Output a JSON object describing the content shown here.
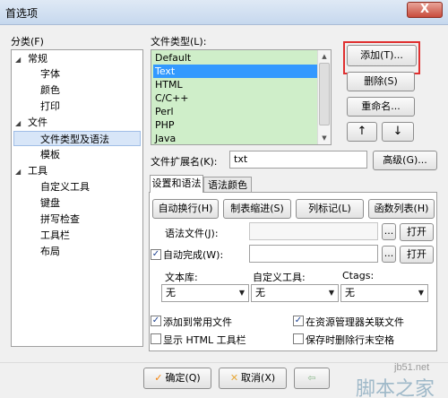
{
  "window": {
    "title": "首选项",
    "close_glyph": "X"
  },
  "category": {
    "label": "分类(F)",
    "items": [
      {
        "label": "常规"
      },
      {
        "label": "字体"
      },
      {
        "label": "颜色"
      },
      {
        "label": "打印"
      },
      {
        "label": "文件"
      },
      {
        "label": "文件类型及语法"
      },
      {
        "label": "模板"
      },
      {
        "label": "工具"
      },
      {
        "label": "自定义工具"
      },
      {
        "label": "键盘"
      },
      {
        "label": "拼写检查"
      },
      {
        "label": "工具栏"
      },
      {
        "label": "布局"
      }
    ],
    "selected": "文件类型及语法"
  },
  "file_types": {
    "label": "文件类型(L):",
    "items": [
      "Default",
      "Text",
      "HTML",
      "C/C++",
      "Perl",
      "PHP",
      "Java"
    ],
    "selected": "Text",
    "list_bg": "#cfeec9"
  },
  "buttons": {
    "add": "添加(T)...",
    "delete": "删除(S)",
    "rename": "重命名...",
    "up": "↑",
    "down": "↓",
    "advanced": "高级(G)...",
    "highlight_color": "#e03030"
  },
  "extension": {
    "label": "文件扩展名(K):",
    "value": "txt"
  },
  "tabs": [
    {
      "label": "设置和语法"
    },
    {
      "label": "语法颜色"
    }
  ],
  "syntax_buttons": {
    "auto_wrap": "自动换行(H)",
    "tab_indent": "制表缩进(S)",
    "column_mark": "列标记(L)",
    "function_list": "函数列表(H)"
  },
  "syntax_file": {
    "label": "语法文件(J):",
    "value": "",
    "browse": "...",
    "open": "打开"
  },
  "auto_complete": {
    "label": "自动完成(W):",
    "checked": true,
    "value": "",
    "browse": "...",
    "open": "打开"
  },
  "dropdowns": [
    {
      "label": "文本库:",
      "value": "无"
    },
    {
      "label": "自定义工具:",
      "value": "无"
    },
    {
      "label": "Ctags:",
      "value": "无"
    }
  ],
  "checkboxes": [
    {
      "label": "添加到常用文件",
      "checked": true
    },
    {
      "label": "在资源管理器关联文件",
      "checked": true
    },
    {
      "label": "显示 HTML 工具栏",
      "checked": false
    },
    {
      "label": "保存时删除行末空格",
      "checked": false
    }
  ],
  "footer": {
    "ok": "确定(Q)",
    "cancel": "取消(X)",
    "ok_icon_color": "#f5820a",
    "cancel_icon_color": "#e8a93a"
  },
  "watermark": {
    "site": "jb51.net",
    "brand": "脚本之家"
  }
}
